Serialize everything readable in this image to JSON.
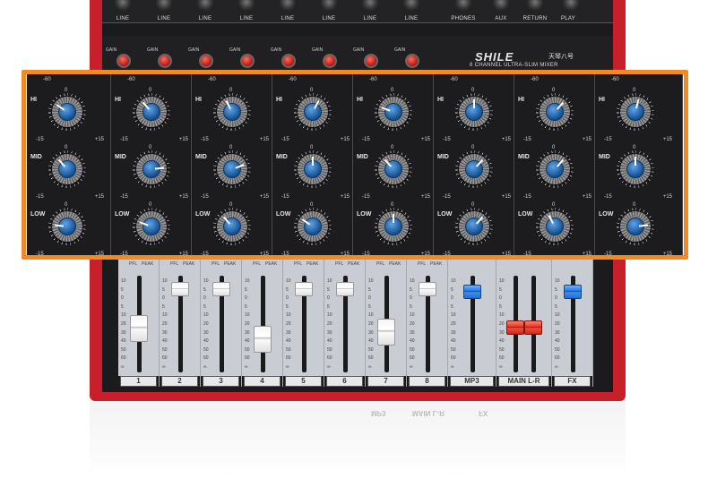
{
  "jacks": {
    "labels": [
      "LINE",
      "LINE",
      "LINE",
      "LINE",
      "LINE",
      "LINE",
      "LINE",
      "LINE",
      "PHONES",
      "AUX",
      "RETURN",
      "PLAY"
    ]
  },
  "gain": {
    "label": "GAIN"
  },
  "brand": {
    "name": "SHILE",
    "chinese": "天琴八号",
    "subtitle": "8 CHANNEL ULTRA-SLIM MIXER",
    "registered": "®"
  },
  "eq": {
    "bands": [
      "HI",
      "MID",
      "LOW"
    ],
    "scale_min": "-15",
    "scale_max": "+15",
    "scale_zero": "0",
    "top_scale": "-60",
    "knob_ticks": [
      "3",
      "6",
      "9",
      "12"
    ],
    "settings": [
      [
        -0.4,
        -0.3,
        -0.6
      ],
      [
        -0.3,
        0.6,
        -0.5
      ],
      [
        -0.2,
        0.5,
        -0.3
      ],
      [
        0.2,
        0.0,
        -0.4
      ],
      [
        -0.5,
        -0.3,
        0.0
      ],
      [
        0.0,
        0.3,
        0.3
      ],
      [
        0.3,
        0.3,
        -0.2
      ],
      [
        0.1,
        0.0,
        0.6
      ]
    ]
  },
  "faders": {
    "pfl": "PFL",
    "peak": "PEAK",
    "scale": [
      "10",
      "5",
      "0",
      "5",
      "10",
      "20",
      "30",
      "40",
      "50",
      "60",
      "∞"
    ],
    "channels": [
      {
        "label": "1",
        "level": 0.56,
        "color": "white"
      },
      {
        "label": "2",
        "level": 0.93,
        "color": "white"
      },
      {
        "label": "3",
        "level": 0.93,
        "color": "white"
      },
      {
        "label": "4",
        "level": 0.44,
        "color": "white"
      },
      {
        "label": "5",
        "level": 0.93,
        "color": "white"
      },
      {
        "label": "6",
        "level": 0.93,
        "color": "white"
      },
      {
        "label": "7",
        "level": 0.52,
        "color": "white"
      },
      {
        "label": "8",
        "level": 0.93,
        "color": "white"
      },
      {
        "label": "MP3",
        "level": 0.9,
        "color": "blue"
      },
      {
        "label": "MAIN L-R",
        "level": 0.5,
        "color": "red"
      },
      {
        "label": "FX",
        "level": 0.9,
        "color": "blue"
      }
    ]
  },
  "reflection": {
    "labels": [
      "MP3",
      "MAIN L-R",
      "FX"
    ]
  }
}
